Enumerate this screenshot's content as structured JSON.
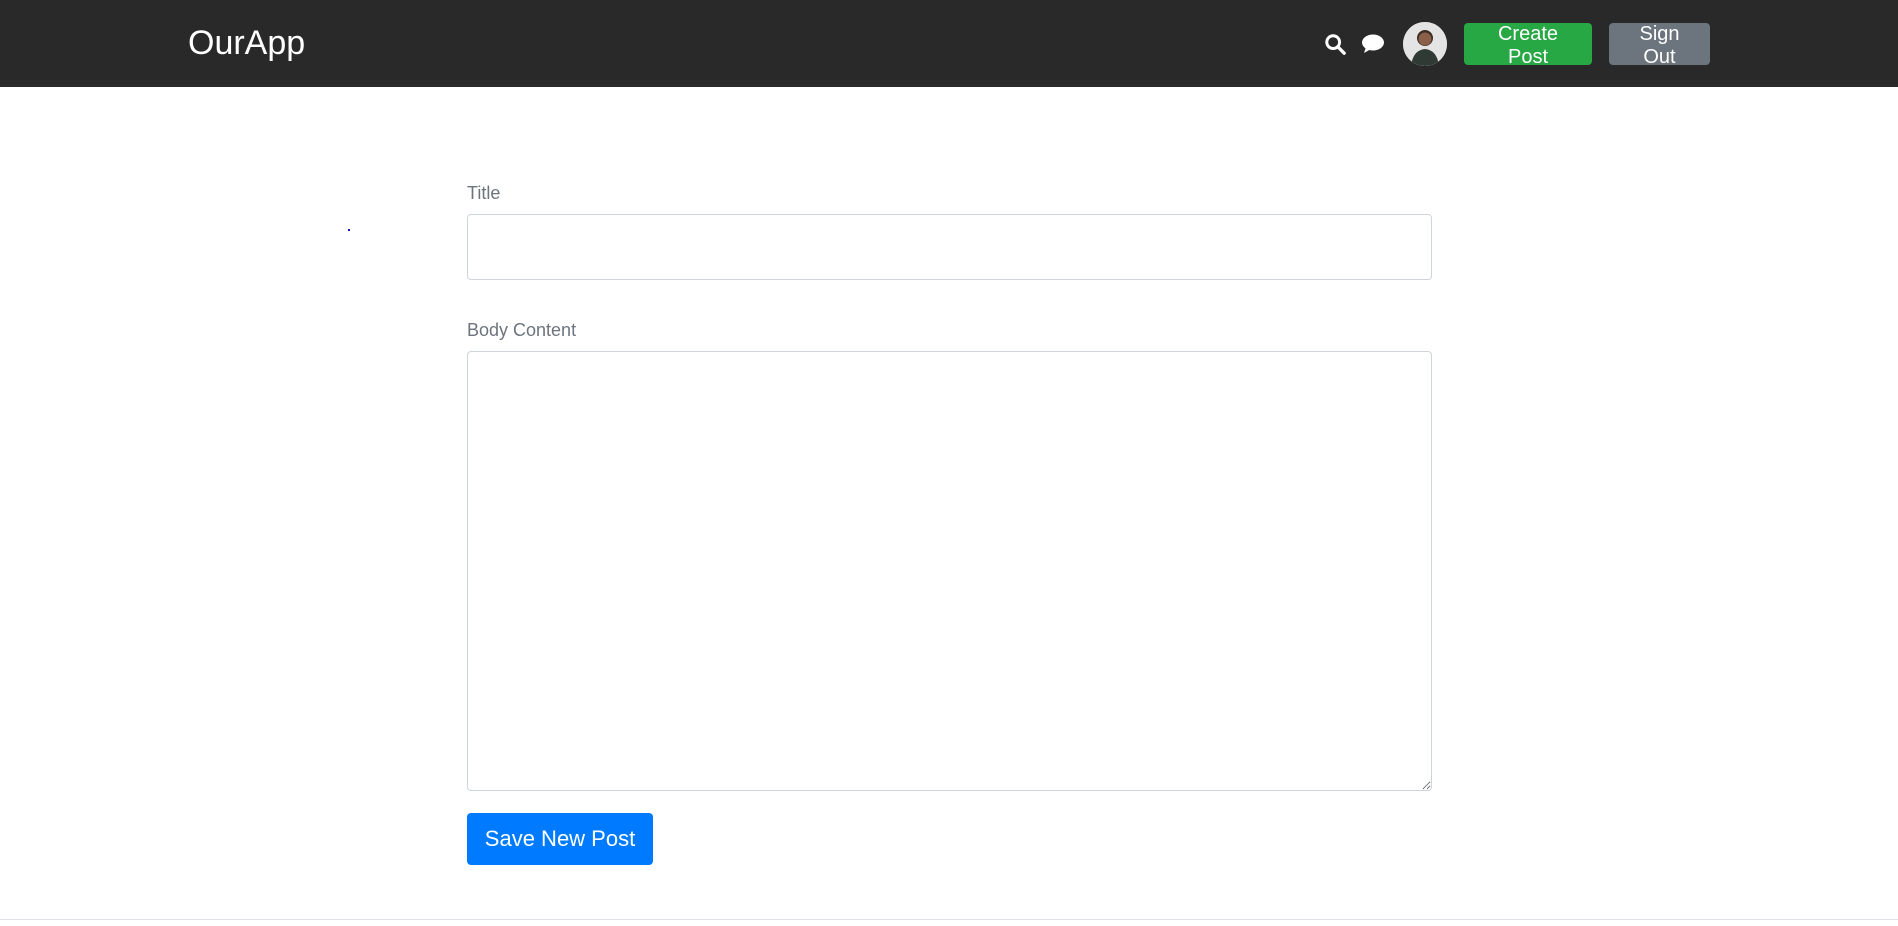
{
  "header": {
    "brand": "OurApp",
    "search_icon": "search-icon",
    "chat_icon": "chat-icon",
    "avatar_alt": "profile avatar",
    "create_post_label": "Create Post",
    "sign_out_label": "Sign Out"
  },
  "form": {
    "title_label": "Title",
    "title_value": "",
    "body_label": "Body Content",
    "body_value": "",
    "submit_label": "Save New Post"
  },
  "colors": {
    "navbar": "#292929",
    "create_button": "#28a745",
    "sign_out_button": "#6c757d",
    "save_button": "#007bff",
    "label_text": "#6c757d"
  }
}
